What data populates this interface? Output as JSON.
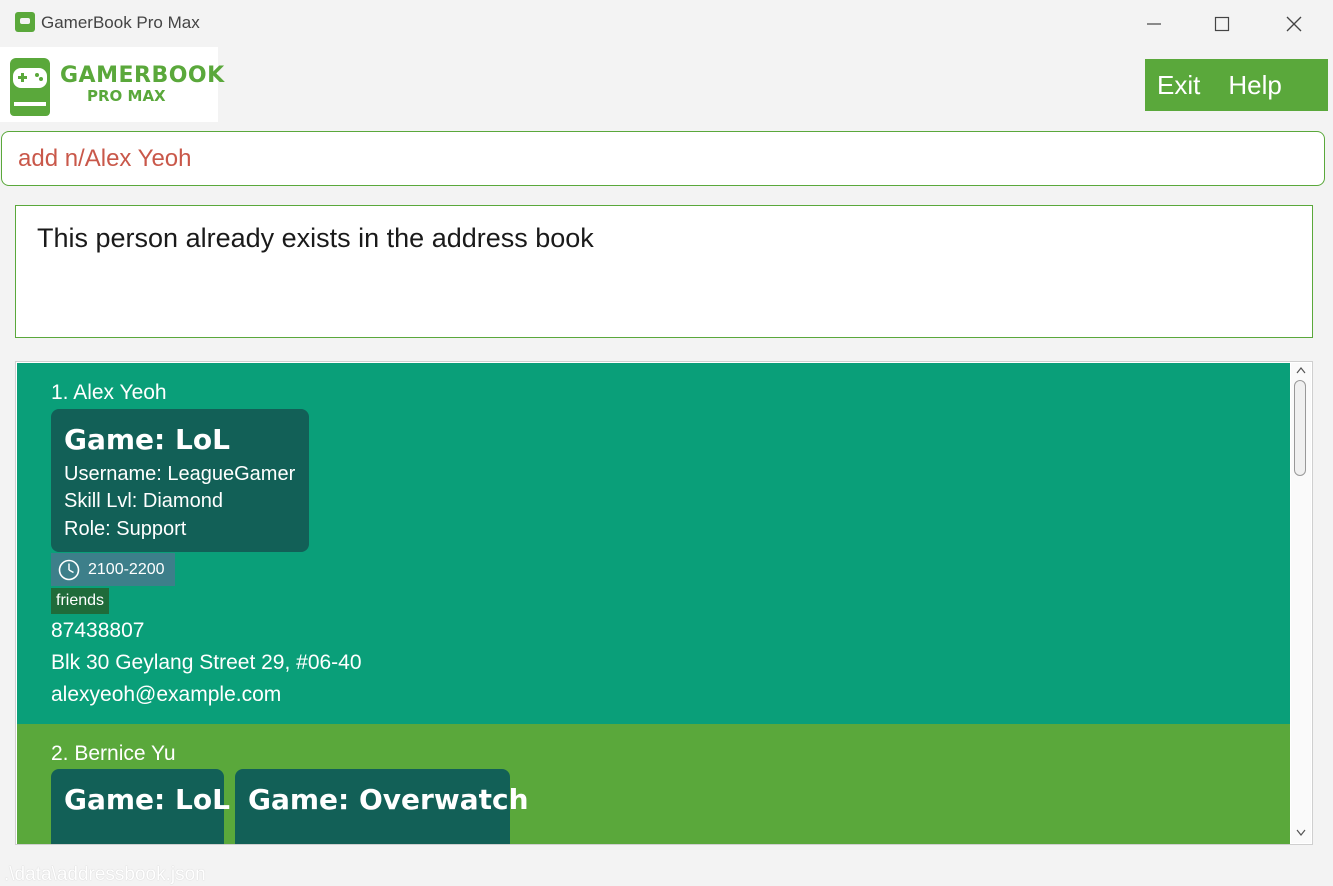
{
  "window": {
    "title": "GamerBook Pro Max"
  },
  "logo": {
    "title": "GAMERBOOK",
    "subtitle": "PRO MAX"
  },
  "menu": {
    "exit": "Exit",
    "help": "Help"
  },
  "command": {
    "value": "add n/Alex Yeoh"
  },
  "result": {
    "text": "This person already exists in the address book"
  },
  "persons": [
    {
      "name": "1. Alex Yeoh",
      "games": [
        {
          "title": "Game: LoL",
          "username": "Username: LeagueGamer",
          "skill": "Skill Lvl: Diamond",
          "role": "Role: Support"
        }
      ],
      "time": "2100-2200",
      "tag": "friends",
      "phone": "87438807",
      "address": "Blk 30 Geylang Street 29, #06-40",
      "email": "alexyeoh@example.com",
      "color": "#0a9f79"
    },
    {
      "name": "2. Bernice Yu",
      "games": [
        {
          "title": "Game: LoL"
        },
        {
          "title": "Game: Overwatch"
        }
      ],
      "color": "#5aa83b"
    }
  ],
  "status": {
    "path": ".\\data\\addressbook.json"
  },
  "colors": {
    "accent": "#5aa83b",
    "card_teal": "#0a9f79",
    "game_box": "#126057",
    "error_text": "#c9584a"
  },
  "icons": [
    "app-icon",
    "minimize-icon",
    "maximize-icon",
    "close-icon",
    "controller-icon",
    "clock-icon"
  ]
}
